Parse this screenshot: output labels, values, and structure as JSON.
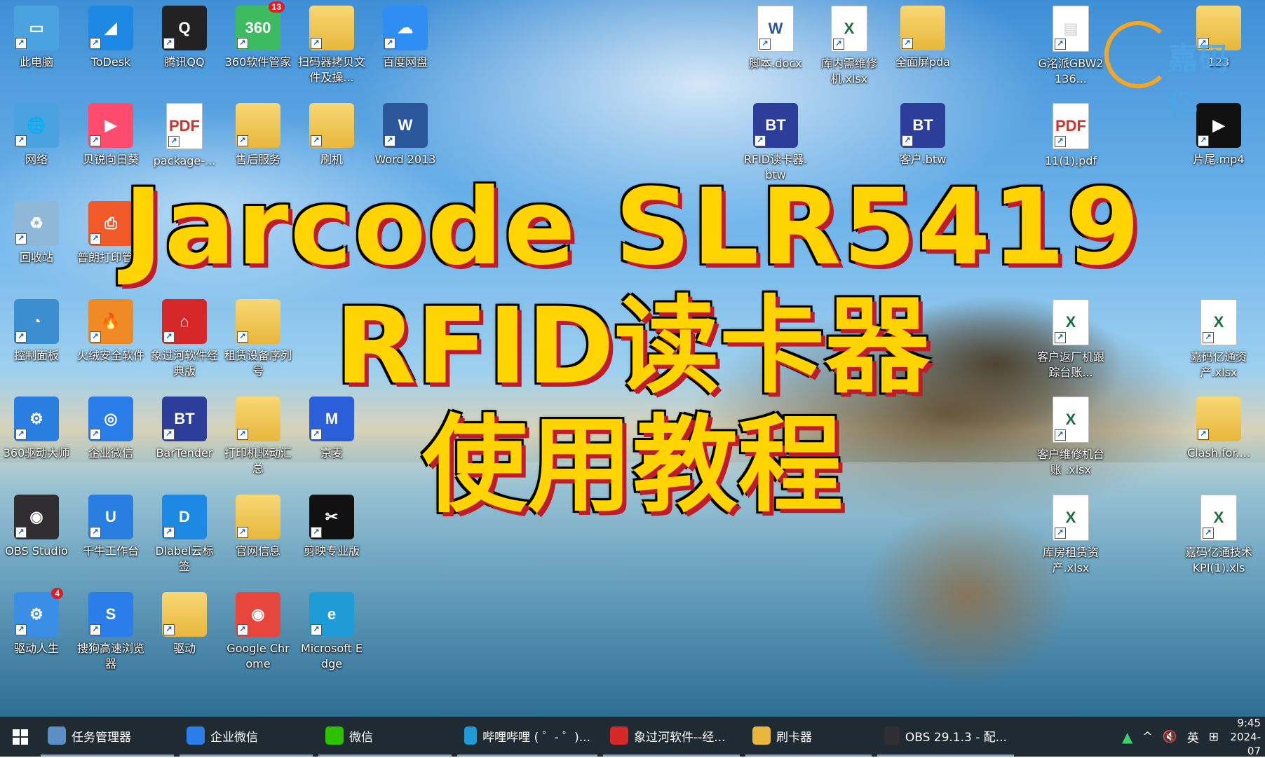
{
  "desktop": {
    "icons": [
      {
        "label": "此电脑",
        "icon": "this-pc-icon",
        "color": "#4aa3df"
      },
      {
        "label": "ToDesk",
        "icon": "todesk-icon",
        "color": "#1e88e5"
      },
      {
        "label": "腾讯QQ",
        "icon": "qq-icon",
        "color": "#222222"
      },
      {
        "label": "360软件管家",
        "icon": "360-software-icon",
        "color": "#3dbb60",
        "badge": "13"
      },
      {
        "label": "扫码器拷贝文件及操...",
        "icon": "folder-icon",
        "color": "#e8b73c"
      },
      {
        "label": "百度网盘",
        "icon": "baidu-netdisk-icon",
        "color": "#2f8ef4"
      },
      {
        "label": "网络",
        "icon": "network-icon",
        "color": "#4aa3df"
      },
      {
        "label": "贝锐向日葵",
        "icon": "sunlogin-icon",
        "color": "#ff4b6e"
      },
      {
        "label": "package-...",
        "icon": "pdf-icon",
        "color": "#d93025"
      },
      {
        "label": "售后服务",
        "icon": "folder-icon",
        "color": "#e8b73c"
      },
      {
        "label": "刷机",
        "icon": "folder-icon",
        "color": "#e8b73c"
      },
      {
        "label": "Word 2013",
        "icon": "word-icon",
        "color": "#2b579a"
      },
      {
        "label": "回收站",
        "icon": "recycle-bin-icon",
        "color": "#8fb8d8"
      },
      {
        "label": "普朗打印管家",
        "icon": "print-manager-icon",
        "color": "#f05a28"
      },
      {
        "label": "控制面板",
        "icon": "control-panel-icon",
        "color": "#3b8ed0"
      },
      {
        "label": "火绒安全软件",
        "icon": "huorong-icon",
        "color": "#f08a24"
      },
      {
        "label": "象过河软件经典版",
        "icon": "xiangguohe-icon",
        "color": "#d62828"
      },
      {
        "label": "租赁设备序列号",
        "icon": "folder-icon",
        "color": "#e8b73c"
      },
      {
        "label": "360驱动大师",
        "icon": "360-driver-icon",
        "color": "#2a7de1"
      },
      {
        "label": "企业微信",
        "icon": "wecom-icon",
        "color": "#2b7de9"
      },
      {
        "label": "BarTender",
        "icon": "bartender-icon",
        "color": "#2c3e9a"
      },
      {
        "label": "打印机驱动汇总",
        "icon": "folder-icon",
        "color": "#e8b73c"
      },
      {
        "label": "京麦",
        "icon": "jingmai-icon",
        "color": "#2b5fd9"
      },
      {
        "label": "OBS Studio",
        "icon": "obs-icon",
        "color": "#302e31"
      },
      {
        "label": "千牛工作台",
        "icon": "qianniu-icon",
        "color": "#2a7de1"
      },
      {
        "label": "Dlabel云标签",
        "icon": "dlabel-icon",
        "color": "#1e88e5"
      },
      {
        "label": "官网信息",
        "icon": "folder-icon",
        "color": "#e8b73c"
      },
      {
        "label": "剪映专业版",
        "icon": "capcut-icon",
        "color": "#111111"
      },
      {
        "label": "驱动人生",
        "icon": "driver-life-icon",
        "color": "#3a8ee6",
        "badge": "4"
      },
      {
        "label": "搜狗高速浏览器",
        "icon": "sogou-browser-icon",
        "color": "#2b7de9"
      },
      {
        "label": "驱动",
        "icon": "folder-icon",
        "color": "#e8b73c"
      },
      {
        "label": "Google Chrome",
        "icon": "chrome-icon",
        "color": "#e8453c"
      },
      {
        "label": "Microsoft Edge",
        "icon": "edge-icon",
        "color": "#1f9bd7"
      },
      {
        "label": "脚本.docx",
        "icon": "word-doc-icon",
        "color": "#2b579a"
      },
      {
        "label": "库内需维修机.xlsx",
        "icon": "excel-icon",
        "color": "#1d6f42"
      },
      {
        "label": "全面屏pda",
        "icon": "folder-icon",
        "color": "#e8b73c"
      },
      {
        "label": "G洺派GBW2136...",
        "icon": "image-file-icon",
        "color": "#dddddd"
      },
      {
        "label": "123",
        "icon": "folder-icon",
        "color": "#e8b73c"
      },
      {
        "label": "RFID读卡器.btw",
        "icon": "bartender-file-icon",
        "color": "#2c3e9a"
      },
      {
        "label": "客户.btw",
        "icon": "bartender-file-icon",
        "color": "#2c3e9a"
      },
      {
        "label": "11(1).pdf",
        "icon": "pdf-icon",
        "color": "#d93025"
      },
      {
        "label": "片尾.mp4",
        "icon": "video-file-icon",
        "color": "#111111"
      },
      {
        "label": "客户返厂机跟踪台账...",
        "icon": "excel-icon",
        "color": "#1d6f42"
      },
      {
        "label": "嘉码亿通资产.xlsx",
        "icon": "excel-icon",
        "color": "#1d6f42"
      },
      {
        "label": "客户维修机台账 .xlsx",
        "icon": "excel-icon",
        "color": "#1d6f42"
      },
      {
        "label": "Clash.for....",
        "icon": "folder-icon",
        "color": "#e8b73c"
      },
      {
        "label": "库房租赁资产.xlsx",
        "icon": "excel-icon",
        "color": "#1d6f42"
      },
      {
        "label": "嘉码亿通技术KPI(1).xls",
        "icon": "excel-icon",
        "color": "#1d6f42"
      }
    ]
  },
  "overlay": {
    "line1": "Jarcode SLR5419",
    "line2": "RFID读卡器",
    "line3": "使用教程",
    "text_color": "#ffd400",
    "shadow_color": "#c01c28"
  },
  "watermark": {
    "text": "嘉码亿"
  },
  "taskbar": {
    "items": [
      {
        "label": "任务管理器",
        "icon": "task-manager-icon",
        "color": "#5a8fc7"
      },
      {
        "label": "企业微信",
        "icon": "wecom-icon",
        "color": "#2b7de9"
      },
      {
        "label": "微信",
        "icon": "wechat-icon",
        "color": "#2dc100"
      },
      {
        "label": "哔哩哔哩 ( ゜- ゜)...",
        "icon": "edge-icon",
        "color": "#1f9bd7"
      },
      {
        "label": "象过河软件--经...",
        "icon": "xiangguohe-icon",
        "color": "#d62828"
      },
      {
        "label": "刷卡器",
        "icon": "folder-icon",
        "color": "#e8b73c"
      },
      {
        "label": "OBS 29.1.3 - 配...",
        "icon": "obs-icon",
        "color": "#302e31"
      }
    ],
    "tray": {
      "wifi": "wifi-icon",
      "chevron": "^",
      "volume": "🔇",
      "ime": "英",
      "ime_grid": "⊞",
      "time": "9:45",
      "date": "2024-07"
    }
  }
}
